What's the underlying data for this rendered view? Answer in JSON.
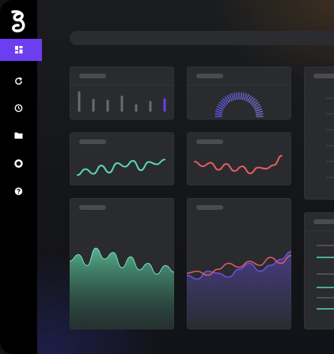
{
  "app": {
    "logo_letter": "g"
  },
  "colors": {
    "accent": "#6d3df0",
    "teal": "#5ad6b6",
    "red": "#e25d63",
    "purple": "#6a52e6",
    "area_green": "#56b891"
  },
  "sidebar": {
    "items": [
      {
        "icon": "dashboard-icon",
        "active": true
      },
      {
        "icon": "refresh-icon",
        "active": false
      },
      {
        "icon": "clock-icon",
        "active": false
      },
      {
        "icon": "folder-icon",
        "active": false
      },
      {
        "icon": "circle-icon",
        "active": false
      },
      {
        "icon": "help-icon",
        "active": false
      }
    ]
  },
  "search": {
    "placeholder": ""
  },
  "widgets": {
    "bars": {
      "values": [
        0.95,
        0.6,
        0.55,
        0.75,
        0.35,
        0.5,
        0.62
      ],
      "highlight_index": 6
    },
    "gauge": {
      "value": 1.0
    },
    "teal_line": {
      "values": [
        0.2,
        0.45,
        0.25,
        0.6,
        0.3,
        0.7,
        0.55,
        0.8,
        0.4,
        0.75,
        0.65,
        0.85
      ]
    },
    "red_line": {
      "values": [
        0.7,
        0.5,
        0.65,
        0.35,
        0.6,
        0.3,
        0.5,
        0.2,
        0.45,
        0.4,
        0.55,
        0.95
      ]
    },
    "area": {
      "values": [
        0.55,
        0.7,
        0.45,
        0.85,
        0.6,
        0.75,
        0.4,
        0.65,
        0.35,
        0.5,
        0.25,
        0.45,
        0.3
      ]
    },
    "dual_lines": {
      "red": [
        0.3,
        0.35,
        0.25,
        0.4,
        0.55,
        0.45,
        0.6,
        0.5,
        0.7,
        0.55,
        0.75
      ],
      "purple": [
        0.25,
        0.15,
        0.35,
        0.3,
        0.2,
        0.4,
        0.55,
        0.35,
        0.5,
        0.65,
        0.85
      ]
    }
  }
}
